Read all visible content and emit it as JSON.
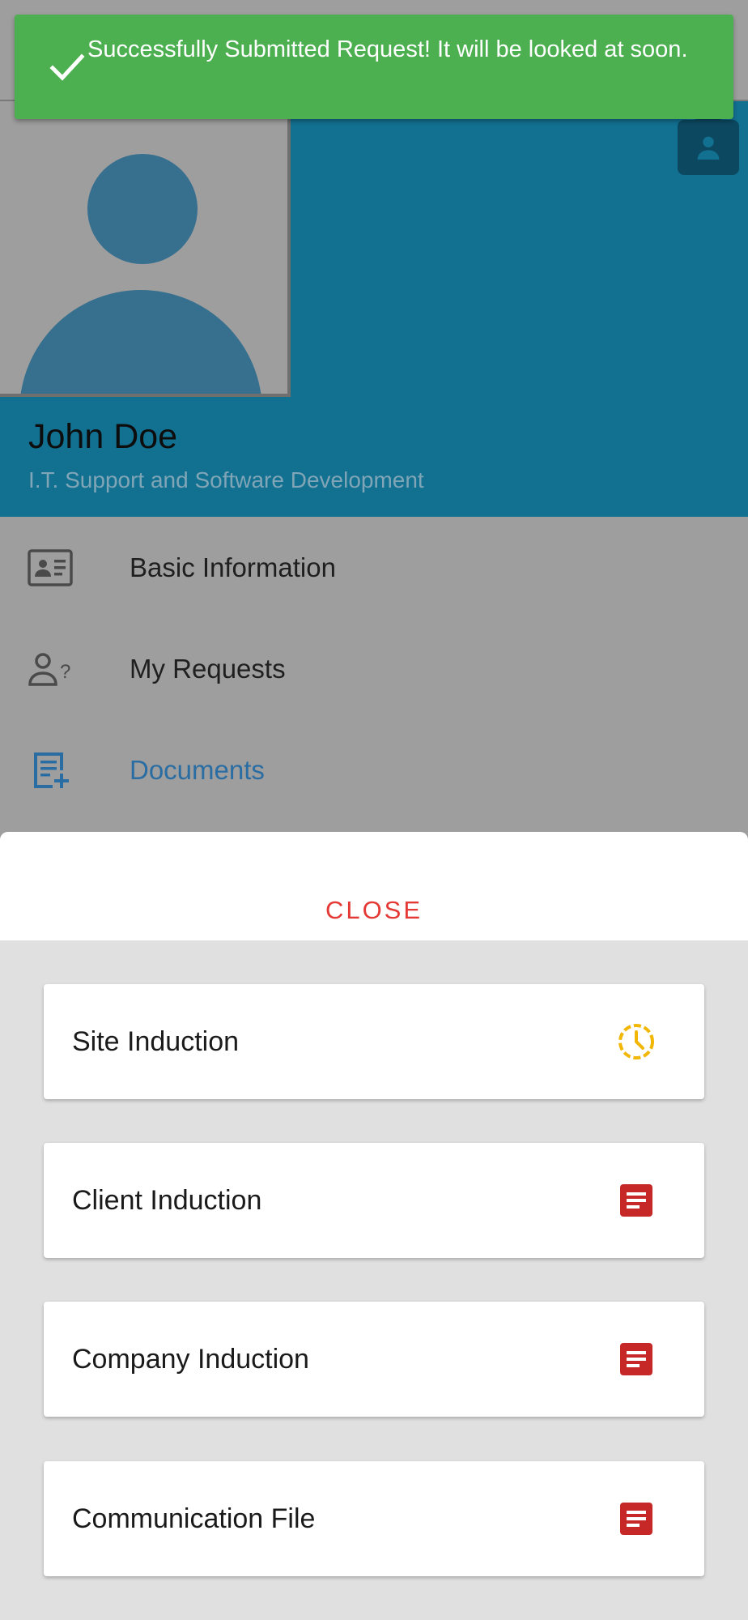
{
  "toast": {
    "message": "Successfully Submitted Request! It will be looked at soon.",
    "icon": "check-icon",
    "color": "#4caf50"
  },
  "profile": {
    "name": "John Doe",
    "department": "I.T. Support and Software Development",
    "header_color": "#127091",
    "avatar_icon": "person-silhouette-icon",
    "camera_icon": "camera-person-icon"
  },
  "menu": {
    "items": [
      {
        "label": "Basic Information",
        "icon": "id-card-icon",
        "active": false
      },
      {
        "label": "My Requests",
        "icon": "person-question-icon",
        "active": false
      },
      {
        "label": "Documents",
        "icon": "document-add-icon",
        "active": true
      }
    ],
    "active_color": "#2a6da3"
  },
  "sheet": {
    "close_label": "CLOSE",
    "close_color": "#e53935",
    "documents": [
      {
        "title": "Site Induction",
        "status_icon": "pending-clock-icon",
        "status_color": "#f2b705"
      },
      {
        "title": "Client Induction",
        "status_icon": "document-icon",
        "status_color": "#c62828"
      },
      {
        "title": "Company Induction",
        "status_icon": "document-icon",
        "status_color": "#c62828"
      },
      {
        "title": "Communication File",
        "status_icon": "document-icon",
        "status_color": "#c62828"
      }
    ]
  }
}
